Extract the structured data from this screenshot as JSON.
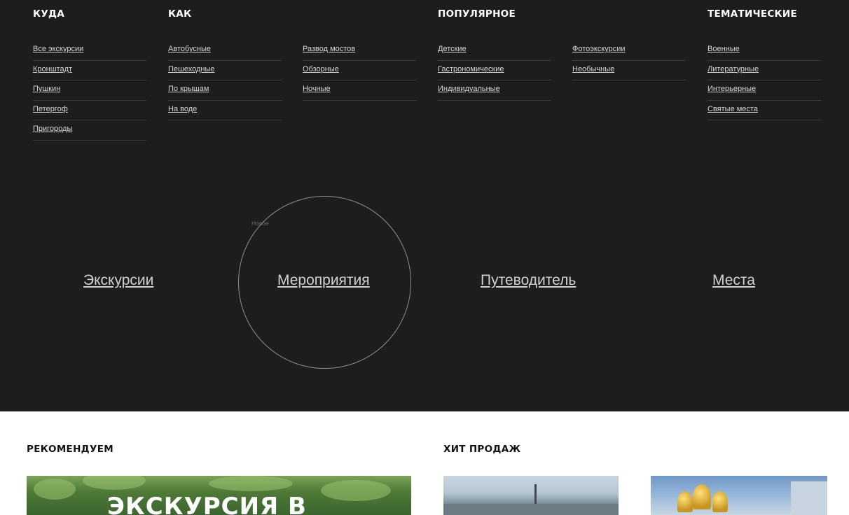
{
  "footer_menu": {
    "columns": [
      {
        "heading": "Куда",
        "links": [
          "Все экскурсии",
          "Кронштадт",
          "Пушкин",
          "Петергоф",
          "Пригороды"
        ]
      },
      {
        "heading": "Как",
        "links": [
          "Автобусные",
          "Пешеходные",
          "По крышам",
          "На воде"
        ]
      },
      {
        "heading": "",
        "links": [
          "Развод мостов",
          "Обзорные",
          "Ночные"
        ]
      },
      {
        "heading": "Популярное",
        "links": [
          "Детские",
          "Гастрономические",
          "Индивидуальные"
        ]
      },
      {
        "heading": "",
        "links": [
          "Фотоэкскурсии",
          "Необычные"
        ]
      },
      {
        "heading": "Тематические",
        "links": [
          "Военные",
          "Литературные",
          "Интерьерные",
          "Святые места"
        ]
      }
    ]
  },
  "main_nav": {
    "items": [
      "Экскурсии",
      "Мероприятия",
      "Путеводитель",
      "Места"
    ],
    "new_badge": "Новое"
  },
  "sections": {
    "recommend_title": "Рекомендуем",
    "recommend_banner": "Экскурсия в",
    "bestseller_title": "Хит продаж"
  },
  "colors": {
    "dark_bg": "#1e1d1d",
    "link": "#d6d6d6",
    "heading": "#ffffff"
  }
}
